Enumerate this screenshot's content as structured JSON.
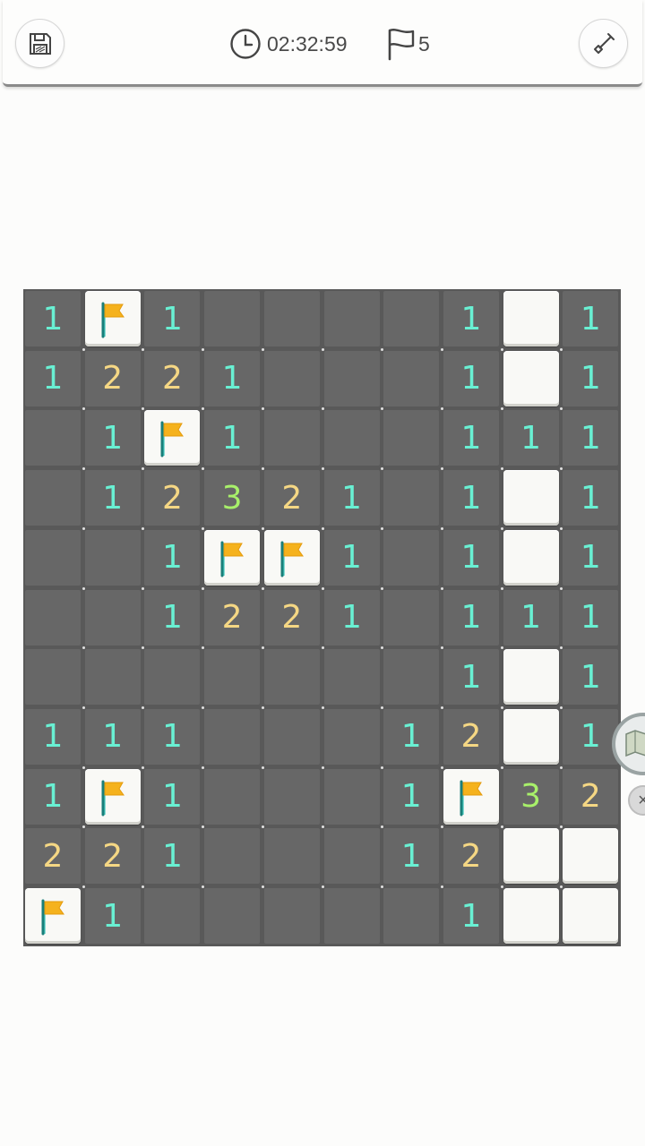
{
  "header": {
    "save_icon": "floppy-disk-icon",
    "timer_icon": "clock-icon",
    "timer": "02:32:59",
    "flag_icon": "flag-outline-icon",
    "flag_count": "5",
    "tool_icon": "shovel-icon"
  },
  "colors": {
    "n1": "#69f0d3",
    "n2": "#f5d784",
    "n3": "#a8f06a",
    "revealed": "#676767",
    "covered": "#f9f9f6",
    "flag": "#f5b21d"
  },
  "side_widget": {
    "icon": "map-icon",
    "close_icon": "close-icon",
    "close": "×"
  },
  "board": {
    "rows": 11,
    "cols": 10,
    "legend": "r = revealed, 0-8 = revealed number, F = flagged, C = covered",
    "grid": [
      [
        "1",
        "F",
        "1",
        "r",
        "r",
        "r",
        "r",
        "1",
        "C",
        "1"
      ],
      [
        "1",
        "2",
        "2",
        "1",
        "r",
        "r",
        "r",
        "1",
        "C",
        "1"
      ],
      [
        "r",
        "1",
        "F",
        "1",
        "r",
        "r",
        "r",
        "1",
        "1",
        "1"
      ],
      [
        "r",
        "1",
        "2",
        "3",
        "2",
        "1",
        "r",
        "1",
        "C",
        "1"
      ],
      [
        "r",
        "r",
        "1",
        "F",
        "F",
        "1",
        "r",
        "1",
        "C",
        "1"
      ],
      [
        "r",
        "r",
        "1",
        "2",
        "2",
        "1",
        "r",
        "1",
        "1",
        "1"
      ],
      [
        "r",
        "r",
        "r",
        "r",
        "r",
        "r",
        "r",
        "1",
        "C",
        "1"
      ],
      [
        "1",
        "1",
        "1",
        "r",
        "r",
        "r",
        "1",
        "2",
        "C",
        "1"
      ],
      [
        "1",
        "F",
        "1",
        "r",
        "r",
        "r",
        "1",
        "F",
        "3",
        "2"
      ],
      [
        "2",
        "2",
        "1",
        "r",
        "r",
        "r",
        "1",
        "2",
        "C",
        "C"
      ],
      [
        "F",
        "1",
        "r",
        "r",
        "r",
        "r",
        "r",
        "1",
        "C",
        "C"
      ]
    ]
  }
}
